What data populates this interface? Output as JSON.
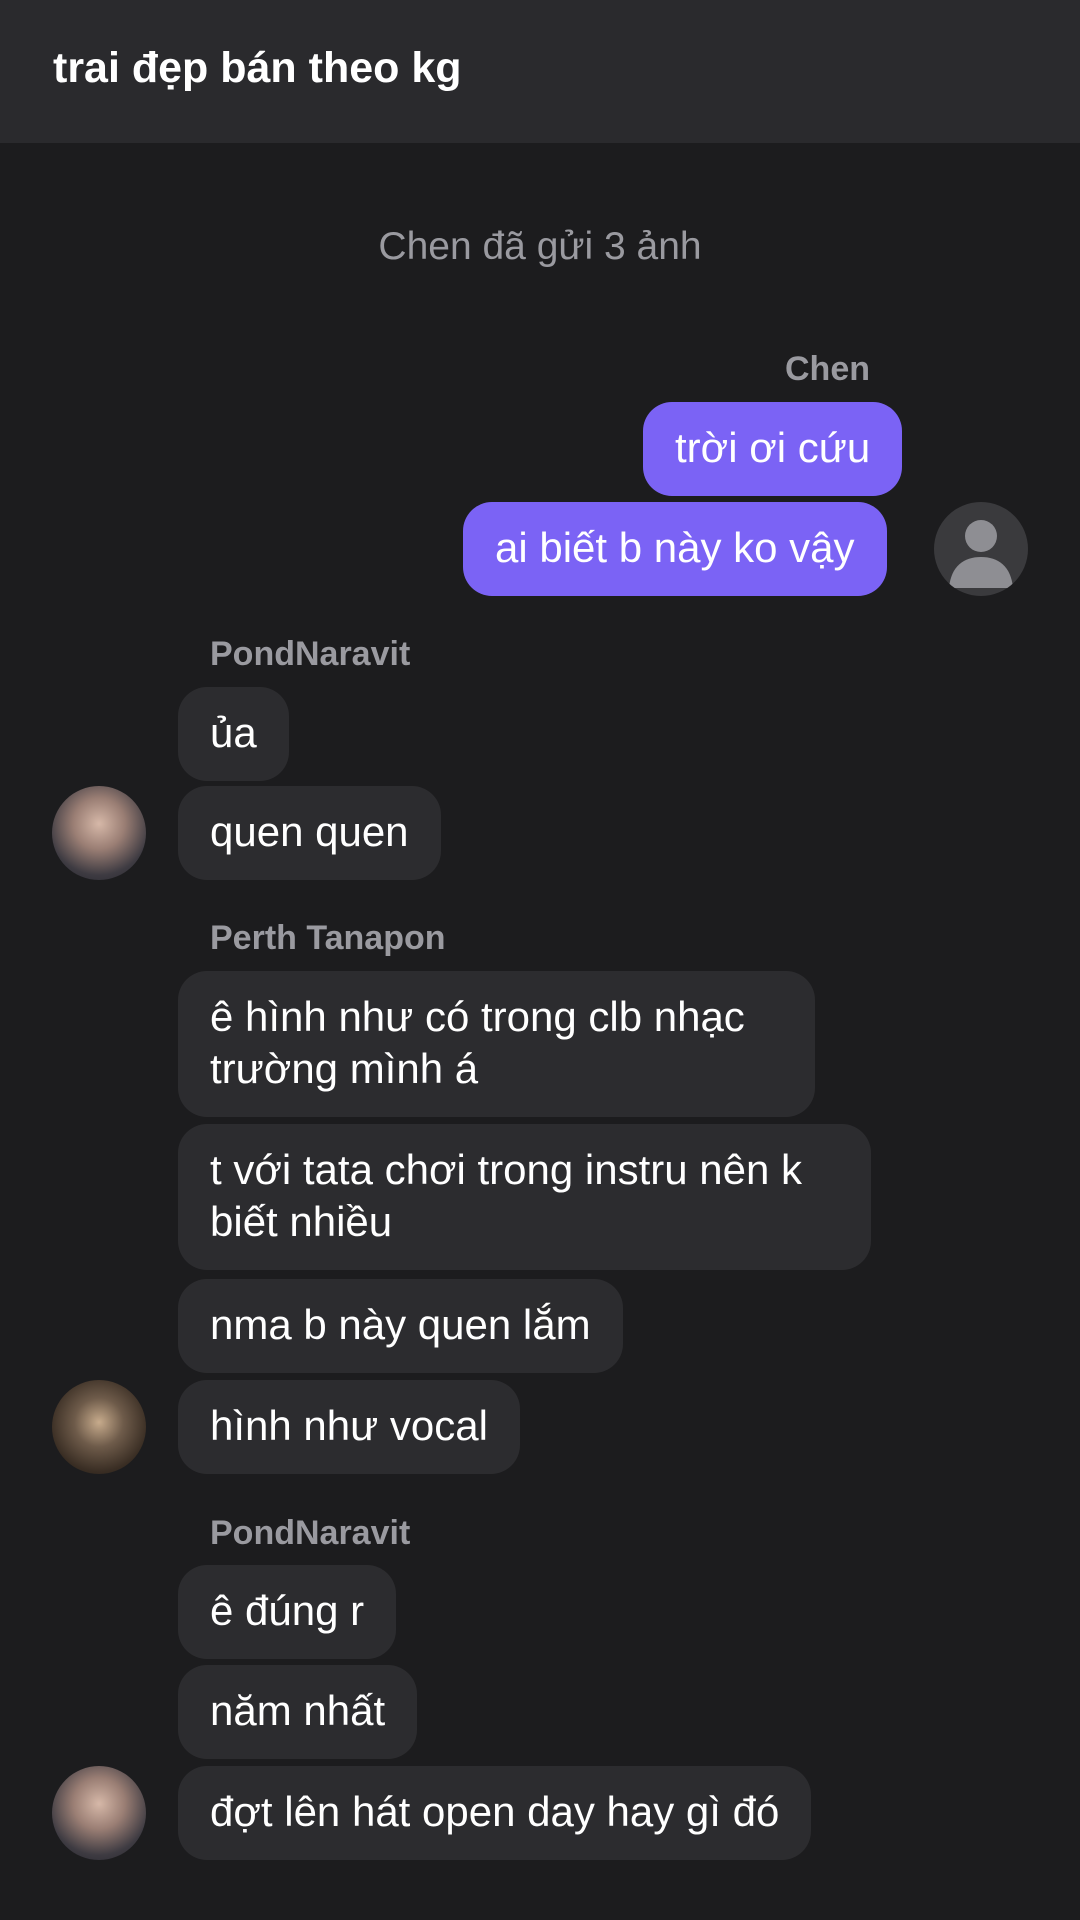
{
  "header": {
    "title": "trai đẹp bán theo kg"
  },
  "system_note": "Chen đã gửi 3 ảnh",
  "groups": [
    {
      "sender": "Chen",
      "messages": [
        "trời ơi cứu",
        "ai biết b này ko vậy"
      ]
    },
    {
      "sender": "PondNaravit",
      "messages": [
        "ủa",
        "quen quen"
      ]
    },
    {
      "sender": "Perth Tanapon",
      "messages": [
        "ê hình như có trong clb nhạc trường mình á",
        "t với tata chơi trong instru nên k biết nhiều",
        "nma b này quen lắm",
        "hình như vocal"
      ]
    },
    {
      "sender": "PondNaravit",
      "messages": [
        "ê đúng r",
        "năm nhất",
        "đợt lên hát open day hay gì đó"
      ]
    }
  ],
  "colors": {
    "background": "#1c1c1e",
    "header": "#2a2a2d",
    "outgoing_bubble": "#7b63f5",
    "incoming_bubble": "#2c2c2f",
    "muted_text": "#9a9aa0"
  },
  "icons": {
    "default_avatar": "person-silhouette-icon"
  }
}
